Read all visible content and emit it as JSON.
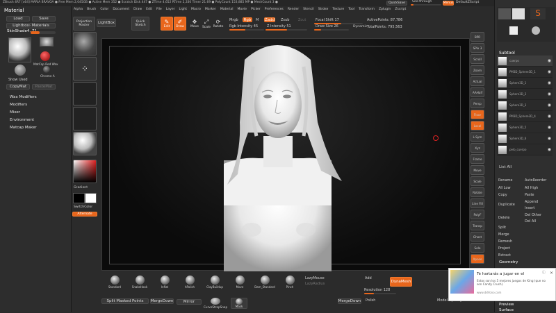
{
  "top_bar": {
    "status": "ZBrush 4R7 [x64]   MARIA BRAVOA   ● Free Mem 2,045GB ● Active Mem 352 ● Scratch Disk 447 ● ZTime 4,652 RTime 2,330 Timer 21.69 ● PolyCount 153,885 MP ● MeshCount 3 ●",
    "quicksave": "QuickSave",
    "seethrough": "See-through",
    "menus_label": "Menus",
    "script_label": "DefaultZScript"
  },
  "menu_bar": [
    "Alpha",
    "Brush",
    "Color",
    "Document",
    "Draw",
    "Edit",
    "File",
    "Layer",
    "Light",
    "Macro",
    "Marker",
    "Material",
    "Movie",
    "Picker",
    "Preferences",
    "Render",
    "Stencil",
    "Stroke",
    "Texture",
    "Tool",
    "Transform",
    "Zplugin",
    "Zscript"
  ],
  "material_panel": {
    "title": "Material",
    "load": "Load",
    "save": "Save",
    "lightbox_materials": "Lightbox› Materials",
    "current_material": "SkinShade4. 71",
    "mat_labels": [
      "MatCap Red Wax",
      "Chrome A"
    ],
    "show_used": "Show Used",
    "copymat": "CopyMat",
    "pastemat": "PasteMat",
    "sections": [
      "Wax Modifiers",
      "Modifiers",
      "Mixer",
      "Environment",
      "Matcap Maker"
    ]
  },
  "toolbar": {
    "projection_master": "Projection Master",
    "lightbox": "LightBox",
    "quick_sketch": "Quick Sketch",
    "edit": "Edit",
    "draw": "Draw",
    "move": "Move",
    "scale": "Scale",
    "rotate": "Rotate",
    "mrgb": "Mrgb",
    "rgb": "Rgb",
    "m": "M",
    "zadd": "Zadd",
    "zsub": "Zsub",
    "zcut": "Zcut",
    "rgb_intensity": "Rgb Intensity 45",
    "z_intensity": "Z Intensity 51",
    "focal_shift": "Focal Shift 17",
    "draw_size": "Draw Size 26",
    "dynamic": "Dynamic",
    "active_points": "ActivePoints: 87,786",
    "total_points": "TotalPoints: 795,563"
  },
  "left_shelf": {
    "gradient": "Gradient",
    "switch_color": "SwitchColor",
    "alternate": "Alternate"
  },
  "right_shelf": [
    "BPR",
    "SPix 3",
    "Scroll",
    "Zoom",
    "Actual",
    "AAHalf",
    "Persp",
    "Floor",
    "Local",
    "L.Sym",
    "Xyz",
    "Frame",
    "Move",
    "Scale",
    "Rotate",
    "Line Fill",
    "PolyF",
    "Transp",
    "Ghost",
    "Solo",
    "Xpose"
  ],
  "subtool_panel": {
    "title": "Subtool",
    "items": [
      "cuerpo",
      "PM3D_Sphere3D_1",
      "Sphere3D_1",
      "Sphere3D_2",
      "Sphere3D_3",
      "PM3D_Sphere3D_4",
      "Sphere3D_5",
      "Sphere3D_6",
      "pelo_cuerpo"
    ],
    "list_all": "List All",
    "rename": "Rename",
    "autoreorder": "AutoReorder",
    "all_low": "All Low",
    "all_high": "All High",
    "copy": "Copy",
    "paste": "Paste",
    "duplicate": "Duplicate",
    "append": "Append",
    "insert": "Insert",
    "delete": "Delete",
    "del_other": "Del Other",
    "del_all": "Del All",
    "split": "Split",
    "merge": "Merge",
    "remesh": "Remesh",
    "project": "Project",
    "extract": "Extract",
    "geometry": "Geometry",
    "preview": "Preview",
    "surface": "Surface"
  },
  "bottom_shelf": {
    "brushes": [
      "Standard",
      "SnakeHook",
      "Inflat",
      "hPolish",
      "ClayBuildup",
      "Move",
      "Dam_Standard",
      "Pinch"
    ],
    "lazymouse": "LazyMouse",
    "lazyradius": "LazyRadius",
    "add": "Add",
    "dynamesh": "DynaMesh",
    "resolution": "Resolution 128",
    "split_masked": "Split Masked Points",
    "mergedown": "MergeDown",
    "mirror": "Mirror",
    "curvestrap": "CurveStrapSnap",
    "mask_brush": "Mask",
    "merge_down2": "MergeDown",
    "polish": "Polish",
    "model_opacity": "Model Opacity 100"
  },
  "ad": {
    "title": "Te hartarás a jugar en el",
    "body": "Estos son los 5 mejores juegos de King (que no son Candy Crush).",
    "url": "www.diéfono.com"
  },
  "colors": {
    "accent": "#e8661c",
    "panel": "#2b2b2b",
    "canvas": "#0f0f0f"
  }
}
